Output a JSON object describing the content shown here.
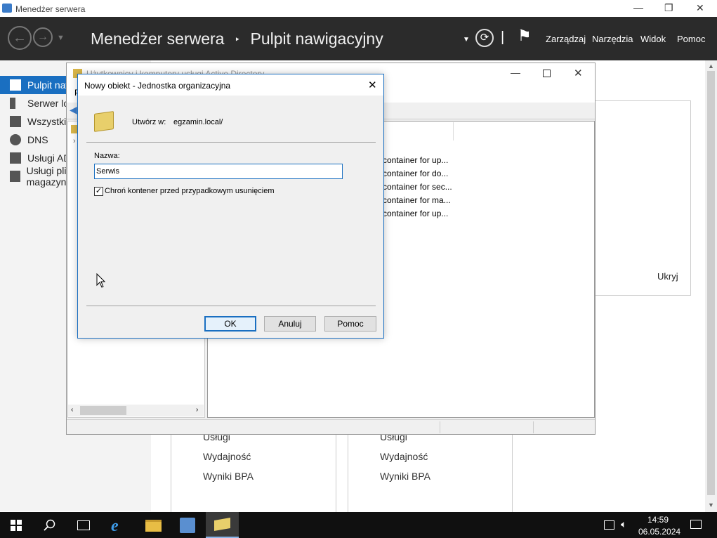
{
  "window": {
    "title": "Menedżer serwera"
  },
  "header": {
    "breadcrumb_app": "Menedżer serwera",
    "breadcrumb_sep": "‣",
    "breadcrumb_page": "Pulpit nawigacyjny",
    "menu": [
      "Zarządzaj",
      "Narzędzia",
      "Widok",
      "Pomoc"
    ],
    "separator": "|"
  },
  "sidebar": {
    "items": [
      {
        "label": "Pulpit nawigacyjny",
        "icon": "dashboard-icon",
        "active": true
      },
      {
        "label": "Serwer lokalny",
        "icon": "server-icon"
      },
      {
        "label": "Wszystkie serwery",
        "icon": "servers-icon"
      },
      {
        "label": "DNS",
        "icon": "dns-icon"
      },
      {
        "label": "Usługi AD DS",
        "icon": "ad-icon"
      },
      {
        "label": "Usługi plików i magazynowania",
        "icon": "files-icon"
      }
    ]
  },
  "dashboard": {
    "tile1": [
      "Usługi",
      "Wydajność",
      "Wyniki BPA"
    ],
    "tile2": [
      "Usługi",
      "Wydajność",
      "Wyniki BPA"
    ],
    "hide_label": "Ukryj"
  },
  "ad_window": {
    "title": "Użytkownicy i komputery usługi Active Directory",
    "p_label": "P",
    "descriptions": [
      "container for up...",
      "container for do...",
      "container for sec...",
      "container for ma...",
      "container for up..."
    ]
  },
  "dialog": {
    "title": "Nowy obiekt - Jednostka organizacyjna",
    "create_in_label": "Utwórz w:",
    "create_in_value": "egzamin.local/",
    "name_label": "Nazwa:",
    "name_value": "Serwis",
    "protect_label": "Chroń kontener przed przypadkowym usunięciem",
    "protect_checked": true,
    "ok": "OK",
    "cancel": "Anuluj",
    "help": "Pomoc"
  },
  "taskbar": {
    "time": "14:59",
    "date": "06.05.2024"
  },
  "colors": {
    "accent": "#1a6fc1",
    "header_bg": "#2b2b2b"
  }
}
